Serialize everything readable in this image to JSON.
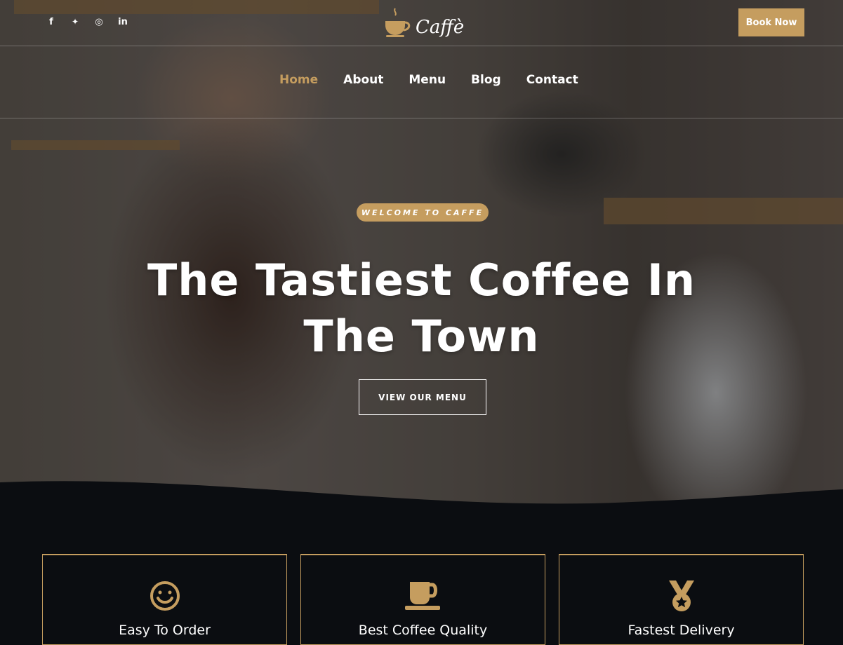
{
  "header": {
    "social": [
      {
        "icon": "facebook-icon",
        "glyph": "f"
      },
      {
        "icon": "twitter-icon",
        "glyph": "🐦"
      },
      {
        "icon": "instagram-icon",
        "glyph": "◎"
      },
      {
        "icon": "linkedin-icon",
        "glyph": "in"
      }
    ],
    "logo": "Caffè",
    "book_label": "Book Now",
    "nav": [
      "Home",
      "About",
      "Menu",
      "Blog",
      "Contact"
    ],
    "active_nav": "Home"
  },
  "hero": {
    "badge": "WELCOME TO CAFFE",
    "title": "The Tastiest Coffee In The Town",
    "cta": "VIEW OUR MENU"
  },
  "features": [
    {
      "title": "Easy To Order",
      "icon": "smile-icon"
    },
    {
      "title": "Best Coffee Quality",
      "icon": "coffee-cup-icon"
    },
    {
      "title": "Fastest Delivery",
      "icon": "medal-icon"
    }
  ],
  "colors": {
    "accent": "#c59d5f",
    "dark": "#0b0d11"
  }
}
